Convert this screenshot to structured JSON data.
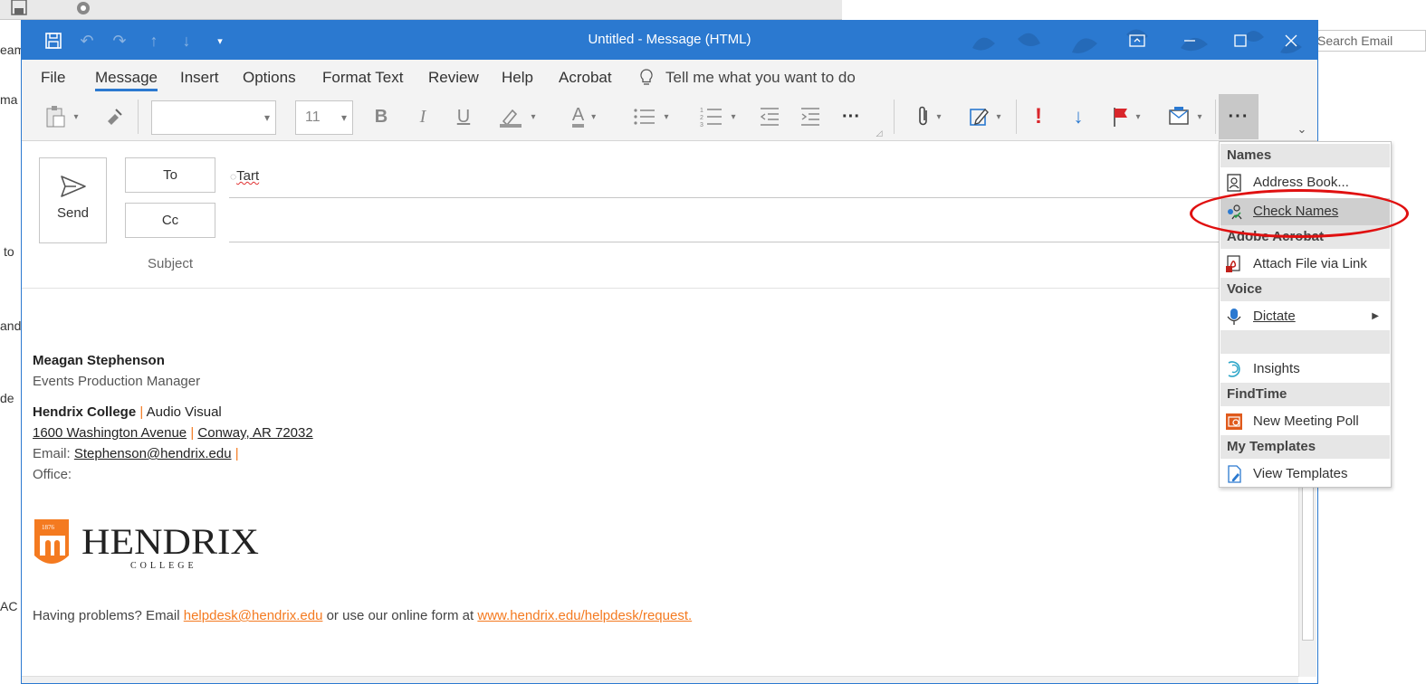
{
  "background": {
    "search_placeholder": "Search Email",
    "left_fragments": [
      "eam",
      "ma",
      "to",
      "and",
      "de",
      "AC"
    ]
  },
  "window": {
    "title": "Untitled  -  Message (HTML)"
  },
  "menu_tabs": [
    "File",
    "Message",
    "Insert",
    "Options",
    "Format Text",
    "Review",
    "Help",
    "Acrobat"
  ],
  "tell_me": "Tell me what you want to do",
  "ribbon": {
    "font_name": "",
    "font_size": "11",
    "bold": "B",
    "italic": "I",
    "underline": "U",
    "font_color": "A",
    "more": "···"
  },
  "compose": {
    "send_label": "Send",
    "to_label": "To",
    "cc_label": "Cc",
    "subject_label": "Subject",
    "to_value": "Tart"
  },
  "signature": {
    "name": "Meagan Stephenson",
    "title": "Events Production Manager",
    "org": "Hendrix College",
    "sep": "|",
    "dept": "Audio Visual",
    "address1": "1600 Washington Avenue",
    "address2": "Conway, AR 72032",
    "email_label": "Email:",
    "email": "Stephenson@hendrix.edu",
    "office_label": "Office:",
    "logo_year": "1876",
    "logo_word": "HENDRIX",
    "logo_sub": "COLLEGE"
  },
  "help_line": {
    "prefix": "Having problems? Email",
    "email": "helpdesk@hendrix.edu",
    "middle": "or use our online form at",
    "url": "www.hendrix.edu/helpdesk/request."
  },
  "overflow_menu": {
    "sections": [
      {
        "header": "Names",
        "items": [
          {
            "label": "Address Book...",
            "icon": "address-book-icon"
          },
          {
            "label": "Check Names",
            "icon": "check-names-icon",
            "highlighted": true
          }
        ]
      },
      {
        "header": "Adobe Acrobat",
        "items": [
          {
            "label": "Attach File via Link",
            "icon": "acrobat-icon"
          }
        ]
      },
      {
        "header": "Voice",
        "items": [
          {
            "label": "Dictate",
            "icon": "microphone-icon",
            "submenu": true
          }
        ]
      },
      {
        "header": "",
        "items": [
          {
            "label": "Insights",
            "icon": "insights-icon"
          }
        ]
      },
      {
        "header": "FindTime",
        "items": [
          {
            "label": "New Meeting Poll",
            "icon": "meeting-poll-icon"
          }
        ]
      },
      {
        "header": "My Templates",
        "items": [
          {
            "label": "View Templates",
            "icon": "templates-icon"
          }
        ]
      }
    ]
  },
  "colors": {
    "title_blue": "#2b79d0",
    "accent_orange": "#f47a20",
    "annotation_red": "#e01010"
  }
}
